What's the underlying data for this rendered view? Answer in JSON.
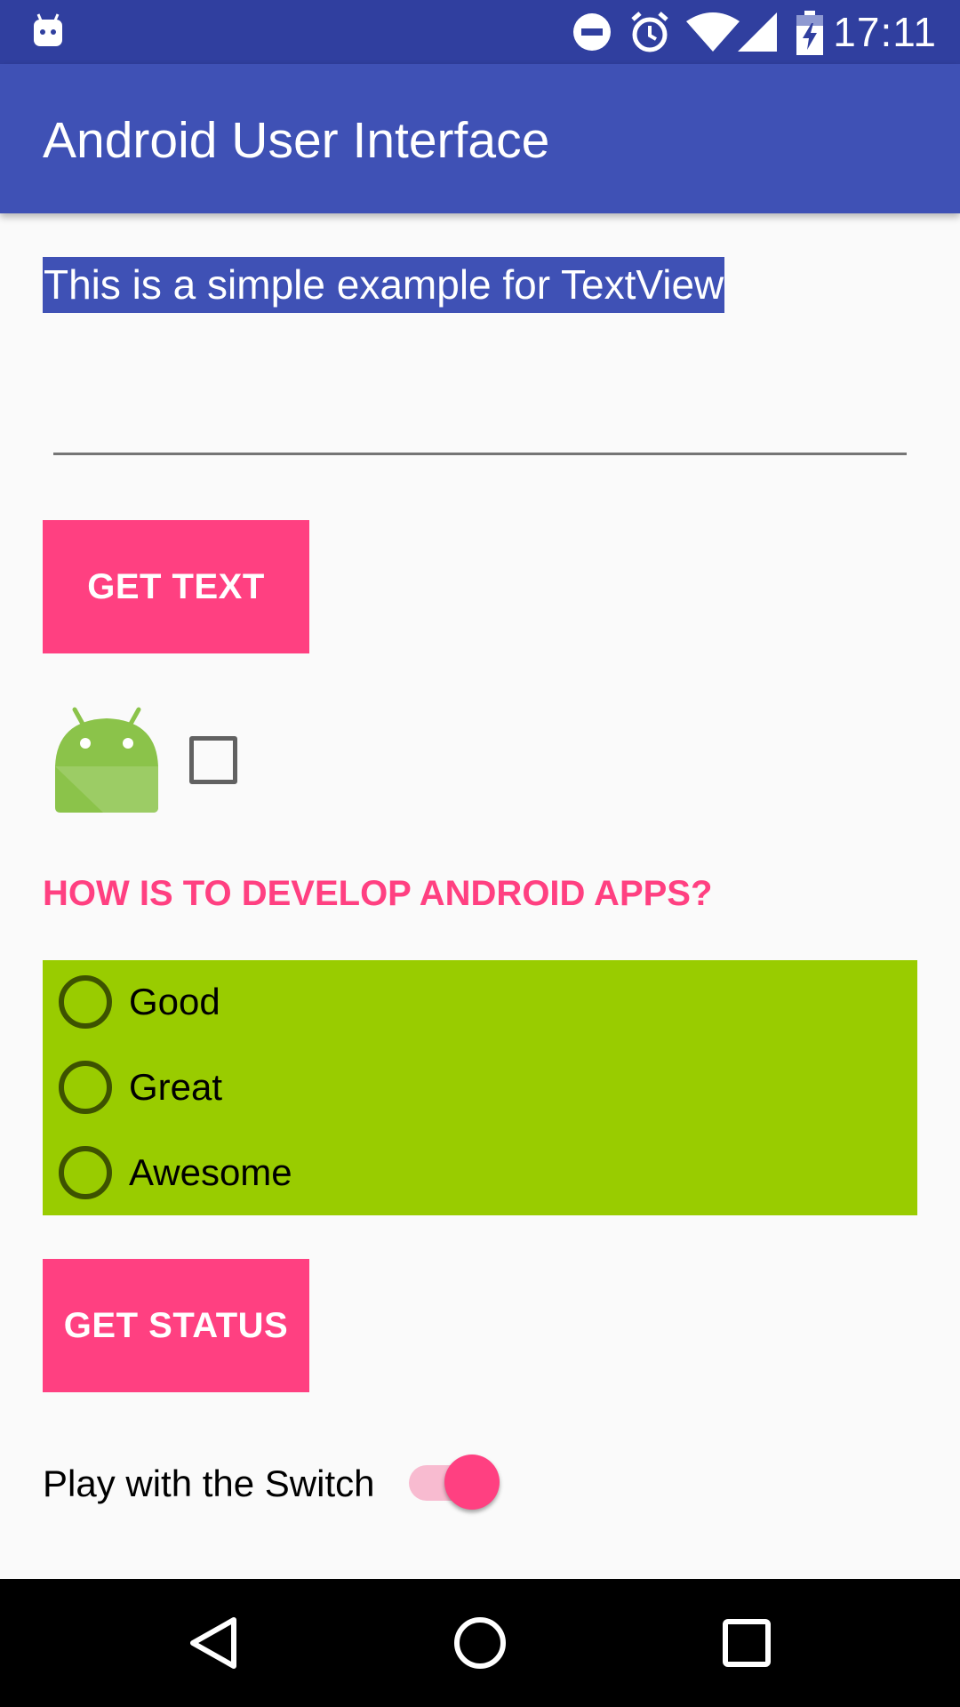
{
  "status_bar": {
    "time": "17:11",
    "icons": [
      "android-debug-icon",
      "do-not-disturb-icon",
      "alarm-icon",
      "wifi-icon",
      "signal-icon",
      "battery-charging-icon"
    ]
  },
  "app_bar": {
    "title": "Android User Interface",
    "color": "#3f51b5"
  },
  "content": {
    "textview": "This is a simple example for TextView",
    "edit_text": {
      "value": "",
      "placeholder": ""
    },
    "get_text_button": "GET TEXT",
    "image_icon": "android-robot-icon",
    "checkbox_checked": false,
    "question": "HOW IS TO DEVELOP ANDROID APPS?",
    "radio_options": [
      {
        "label": "Good",
        "selected": false
      },
      {
        "label": "Great",
        "selected": false
      },
      {
        "label": "Awesome",
        "selected": false
      }
    ],
    "get_status_button": "GET STATUS",
    "switch_label": "Play with the Switch",
    "switch_on": true
  },
  "colors": {
    "accent": "#ff4081",
    "primary": "#3f51b5",
    "primary_dark": "#303f9f",
    "radio_group_bg": "#99cc00"
  },
  "nav_bar": {
    "buttons": [
      "back-icon",
      "home-icon",
      "recents-icon"
    ]
  }
}
